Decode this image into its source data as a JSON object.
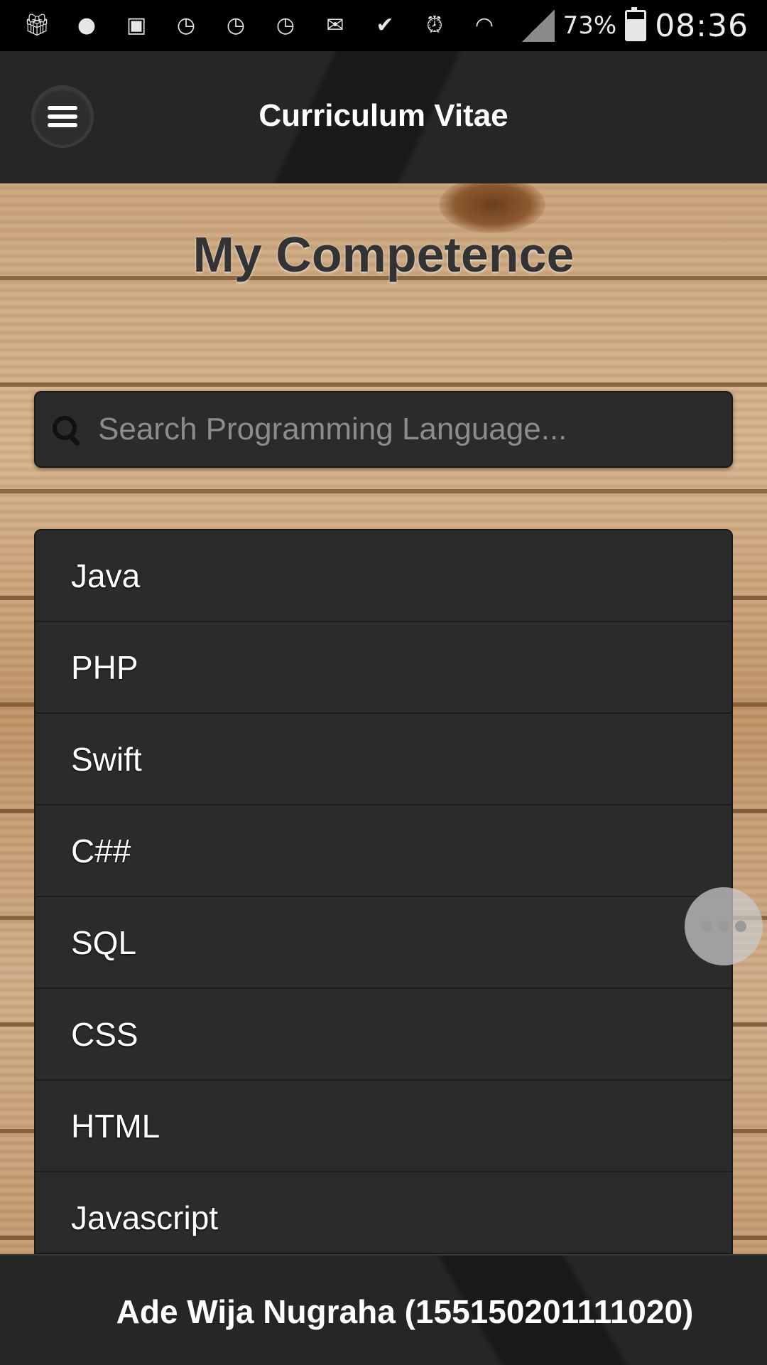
{
  "status_bar": {
    "icons": [
      "gift-icon",
      "line-icon",
      "image-icon",
      "clock-icon",
      "clock-icon",
      "clock-icon",
      "mail-icon",
      "check-icon",
      "alarm-icon",
      "wifi-icon",
      "signal-icon"
    ],
    "battery": "73%",
    "battery_level": 0.73,
    "time": "08:36"
  },
  "header": {
    "title": "Curriculum Vitae",
    "menu_icon": "hamburger-icon"
  },
  "main": {
    "title": "My Competence",
    "search": {
      "placeholder": "Search Programming Language...",
      "value": ""
    },
    "items": [
      {
        "label": "Java"
      },
      {
        "label": "PHP"
      },
      {
        "label": "Swift"
      },
      {
        "label": "C##"
      },
      {
        "label": "SQL"
      },
      {
        "label": "CSS"
      },
      {
        "label": "HTML"
      },
      {
        "label": "Javascript"
      }
    ]
  },
  "footer": {
    "text": "Ade Wija Nugraha (155150201111020)"
  },
  "colors": {
    "bar_background": "#262626",
    "list_background": "#2b2b2b",
    "text": "#ffffff"
  }
}
